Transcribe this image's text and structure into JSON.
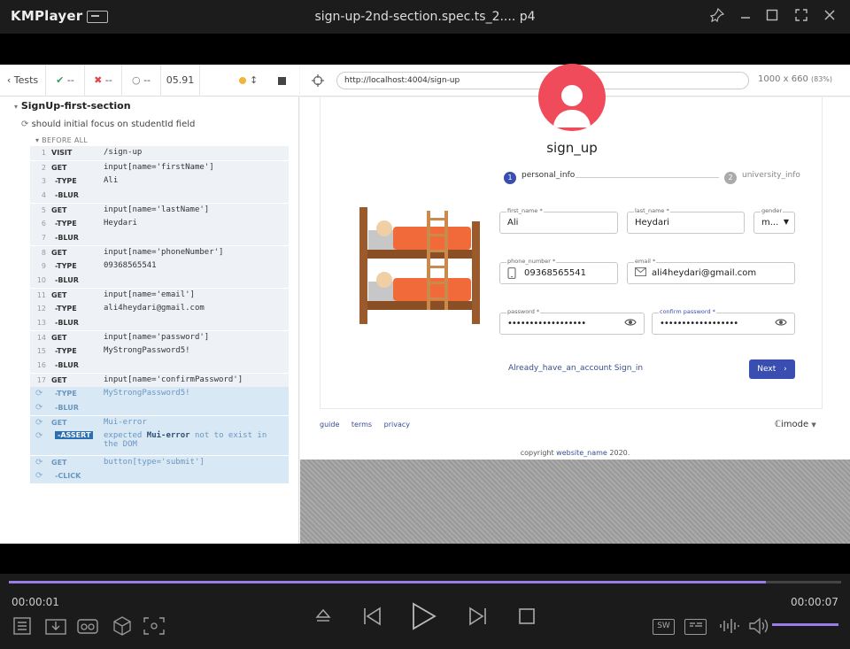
{
  "player": {
    "app_name": "KMPlayer",
    "window_title": "sign-up-2nd-section.spec.ts_2.... p4",
    "time_elapsed": "00:00:01",
    "time_total": "00:00:07",
    "seek_progress_percent": 91,
    "accent_color": "#9a7ce6"
  },
  "cypress": {
    "back_label": "Tests",
    "passed": "--",
    "failed": "--",
    "pending": "--",
    "duration": "05.91",
    "url": "http://localhost:4004/sign-up",
    "viewport": "1000 x 660",
    "scale": "(83%)",
    "spec_title": "SignUp-first-section",
    "test_title": "should initial focus on studentId field",
    "before_all": "BEFORE ALL",
    "commands": [
      {
        "num": "1",
        "name": "VISIT",
        "msg": "/sign-up"
      },
      {
        "num": "2",
        "name": "GET",
        "msg": "input[name='firstName']"
      },
      {
        "num": "3",
        "name": "-TYPE",
        "msg": "Ali"
      },
      {
        "num": "4",
        "name": "-BLUR",
        "msg": ""
      },
      {
        "num": "5",
        "name": "GET",
        "msg": "input[name='lastName']"
      },
      {
        "num": "6",
        "name": "-TYPE",
        "msg": "Heydari"
      },
      {
        "num": "7",
        "name": "-BLUR",
        "msg": ""
      },
      {
        "num": "8",
        "name": "GET",
        "msg": "input[name='phoneNumber']"
      },
      {
        "num": "9",
        "name": "-TYPE",
        "msg": "09368565541"
      },
      {
        "num": "10",
        "name": "-BLUR",
        "msg": ""
      },
      {
        "num": "11",
        "name": "GET",
        "msg": "input[name='email']"
      },
      {
        "num": "12",
        "name": "-TYPE",
        "msg": "ali4heydari@gmail.com"
      },
      {
        "num": "13",
        "name": "-BLUR",
        "msg": ""
      },
      {
        "num": "14",
        "name": "GET",
        "msg": "input[name='password']"
      },
      {
        "num": "15",
        "name": "-TYPE",
        "msg": "MyStrongPassword5!"
      },
      {
        "num": "16",
        "name": "-BLUR",
        "msg": ""
      },
      {
        "num": "17",
        "name": "GET",
        "msg": "input[name='confirmPassword']"
      },
      {
        "num": "",
        "name": "-TYPE",
        "msg": "MyStrongPassword5!"
      },
      {
        "num": "",
        "name": "-BLUR",
        "msg": ""
      },
      {
        "num": "",
        "name": "GET",
        "msg": "Mui-error"
      },
      {
        "num": "",
        "name": "-ASSERT",
        "msg": "expected",
        "target": "Mui-error",
        "rest": "not to exist in",
        "rest2": "the DOM"
      },
      {
        "num": "",
        "name": "GET",
        "msg": "button[type='submit']"
      },
      {
        "num": "",
        "name": "-CLICK",
        "msg": ""
      }
    ]
  },
  "app": {
    "title": "sign_up",
    "step1_num": "1",
    "step1_label": "personal_info",
    "step2_num": "2",
    "step2_label": "university_info",
    "first_name_label": "first_name *",
    "first_name": "Ali",
    "last_name_label": "last_name *",
    "last_name": "Heydari",
    "gender_label": "gender",
    "gender": "m...",
    "phone_label": "phone_number *",
    "phone": "09368565541",
    "email_label": "email *",
    "email": "ali4heydari@gmail.com",
    "password_label": "password *",
    "password": "••••••••••••••••••",
    "confirm_label": "confirm password *",
    "confirm": "••••••••••••••••••",
    "signin_link": "Already_have_an_account Sign_in",
    "next": "Next",
    "footer_guide": "guide",
    "footer_terms": "terms",
    "footer_privacy": "privacy",
    "lang": "ℂimode",
    "copyright_pre": "copyright",
    "copyright_link": "website_name",
    "copyright_post": "2020.",
    "brand_color": "#3a4db0",
    "avatar_color": "#ef4b5b"
  }
}
